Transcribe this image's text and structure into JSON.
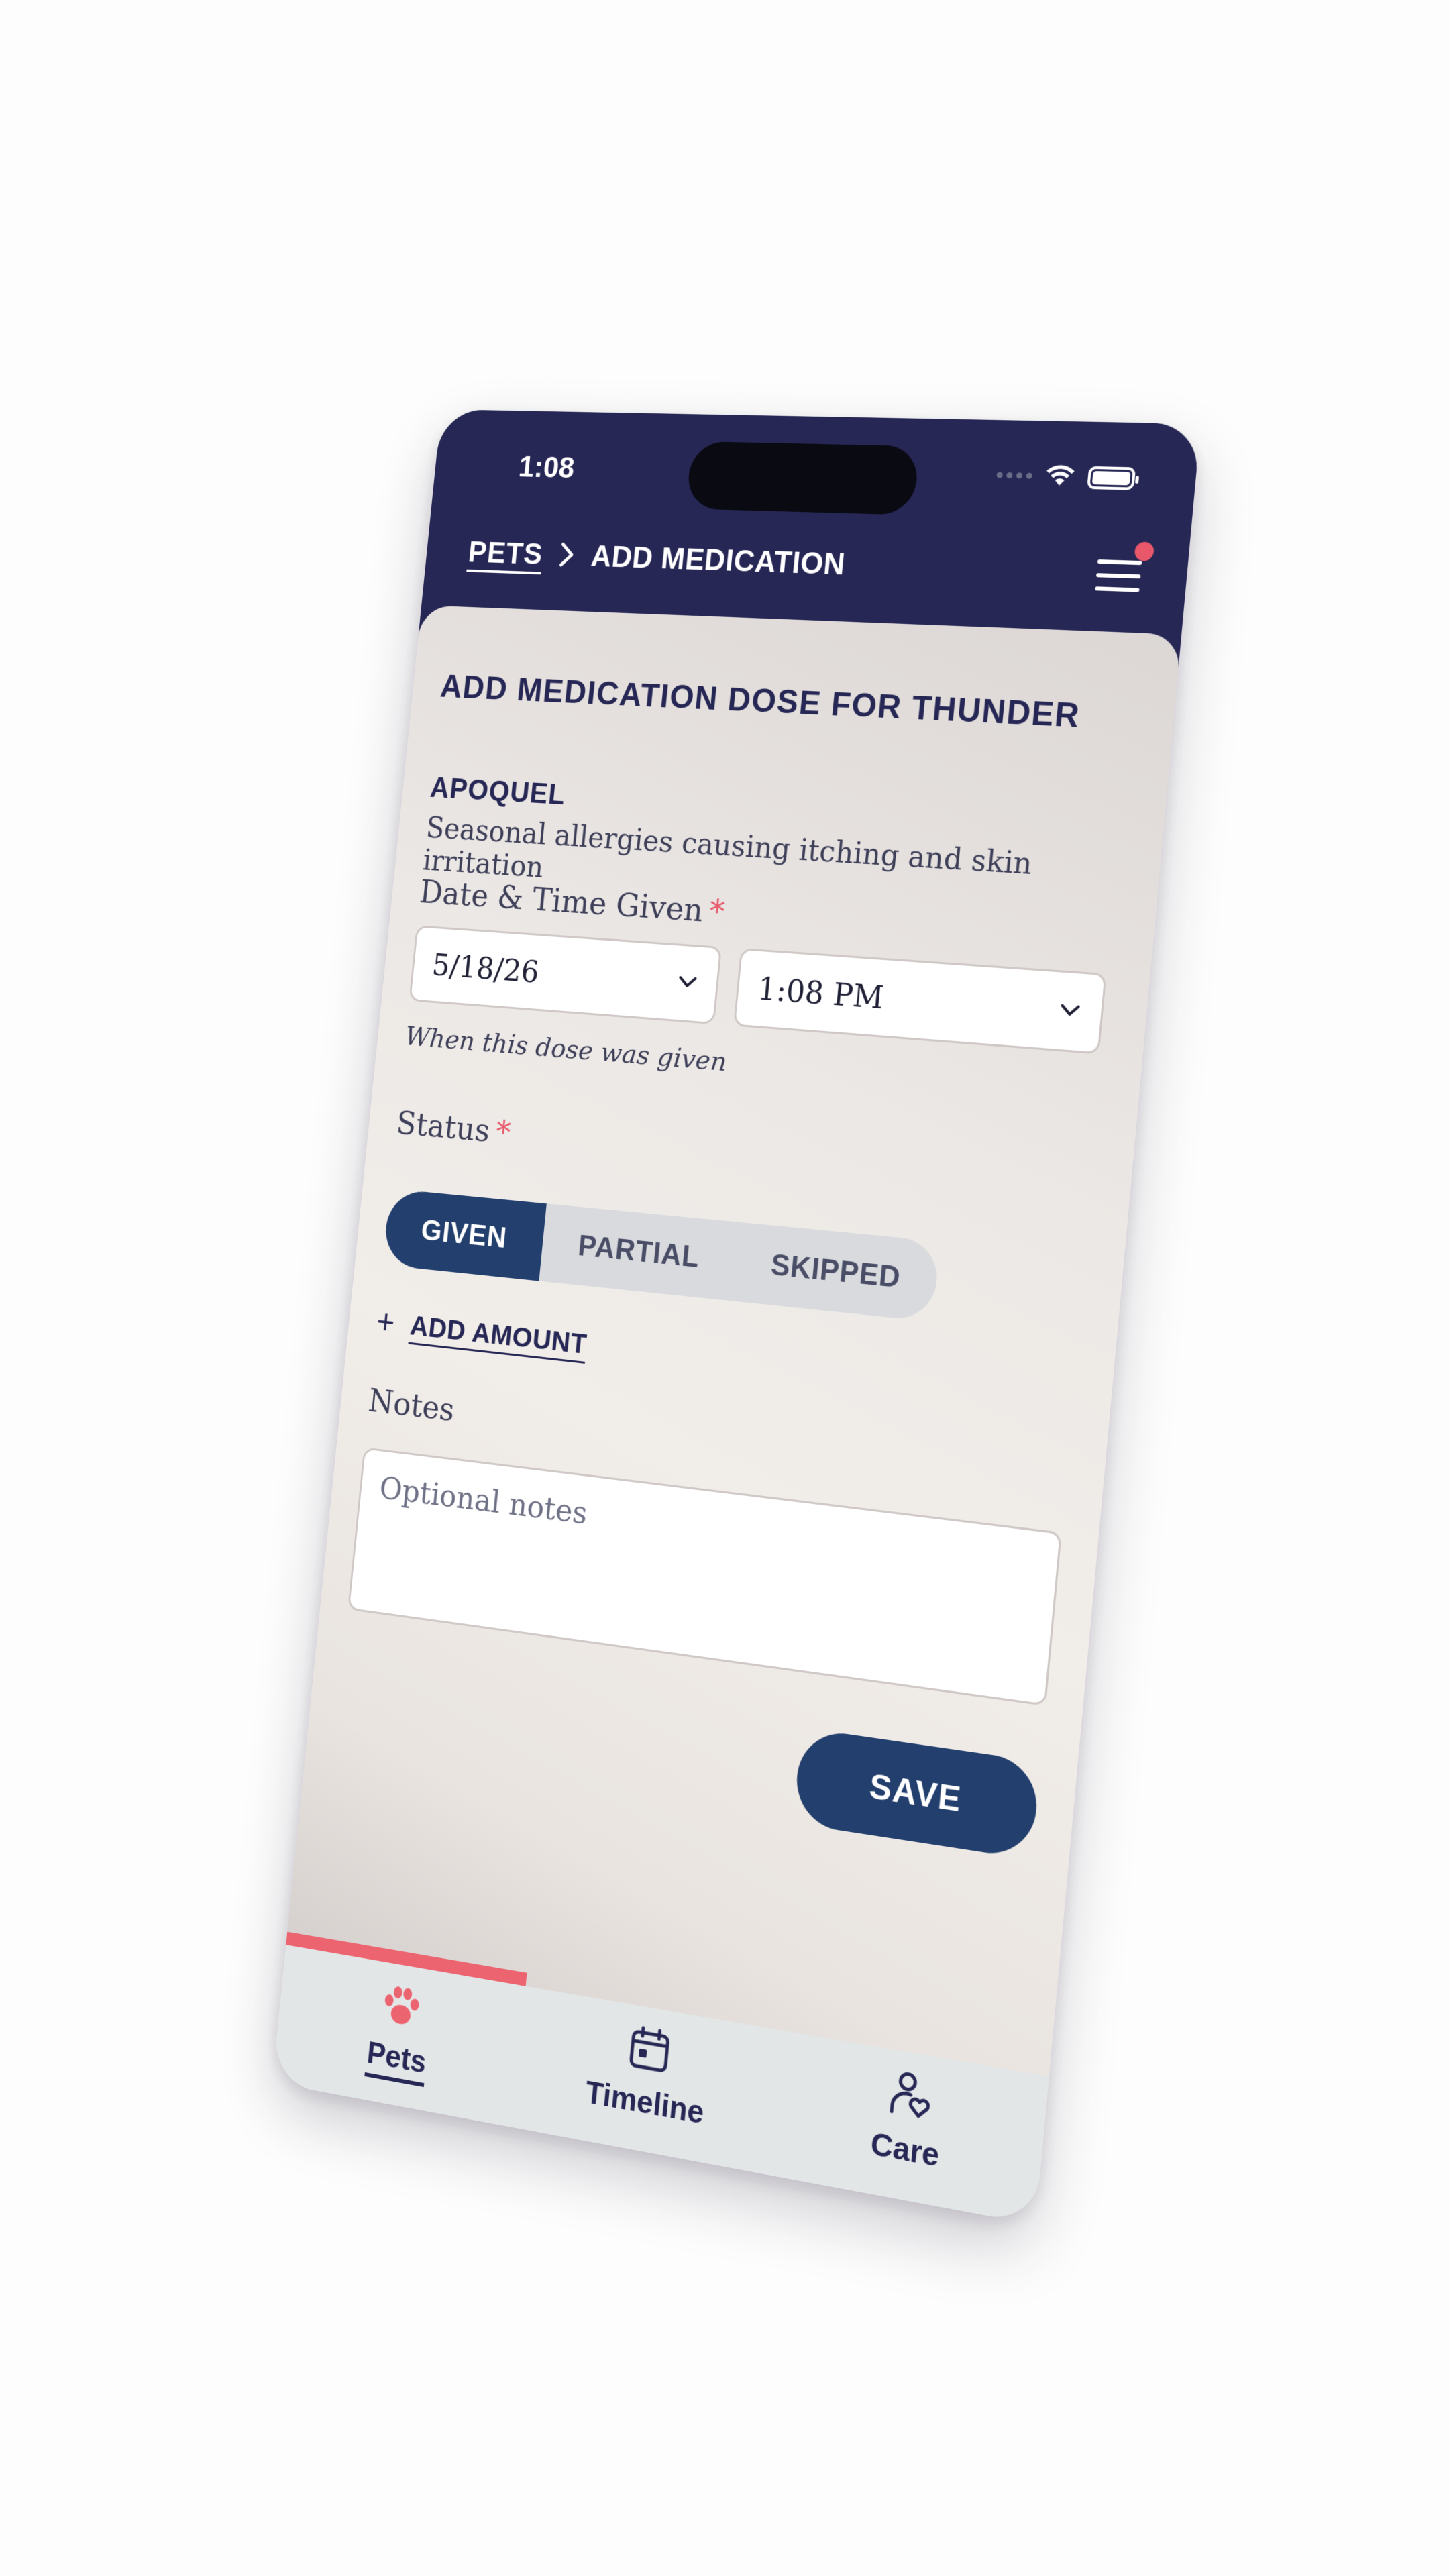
{
  "status_bar": {
    "time": "1:08"
  },
  "header": {
    "breadcrumb_parent": "PETS",
    "breadcrumb_current": "ADD MEDICATION"
  },
  "form": {
    "title": "ADD MEDICATION DOSE FOR THUNDER",
    "medication_name": "APOQUEL",
    "medication_description": "Seasonal allergies causing itching and skin irritation",
    "datetime_label": "Date & Time Given",
    "required_marker": "*",
    "date_value": "5/18/26",
    "time_value": "1:08 PM",
    "datetime_hint": "When this dose was given",
    "status_label": "Status",
    "status_options": [
      "GIVEN",
      "PARTIAL",
      "SKIPPED"
    ],
    "status_selected": "GIVEN",
    "add_amount_label": "ADD AMOUNT",
    "notes_label": "Notes",
    "notes_placeholder": "Optional notes",
    "save_label": "SAVE"
  },
  "tabbar": {
    "items": [
      {
        "label": "Pets",
        "icon": "paw-icon"
      },
      {
        "label": "Timeline",
        "icon": "calendar-icon"
      },
      {
        "label": "Care",
        "icon": "person-heart-icon"
      }
    ],
    "active": "Pets"
  },
  "colors": {
    "header_bg": "#262755",
    "primary": "#233f6e",
    "accent": "#e8576a",
    "segment_bg": "#d8dade",
    "tabbar_bg": "#e3e6e7"
  }
}
